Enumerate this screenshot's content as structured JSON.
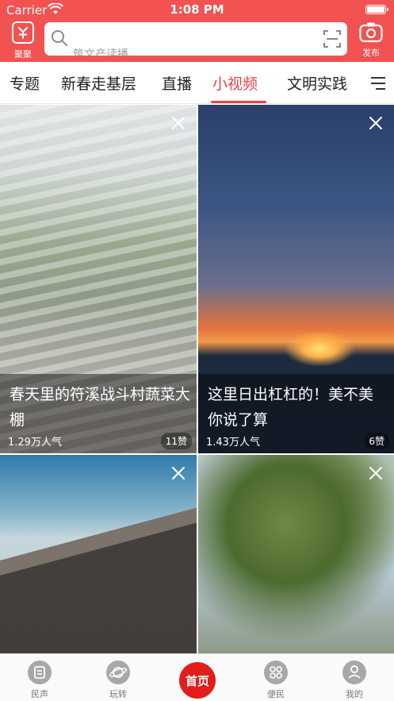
{
  "status_bar": {
    "carrier": "Carrier",
    "time": "1:08 PM"
  },
  "header": {
    "left_button_label": "聚聚",
    "search_placeholder": "筑文产读播",
    "publish_label": "发布"
  },
  "tabs": [
    {
      "label": "专题"
    },
    {
      "label": "新春走基层"
    },
    {
      "label": "直播"
    },
    {
      "label": "小视频",
      "active": true
    },
    {
      "label": "文明实践"
    }
  ],
  "cards": [
    {
      "title": "春天里的符溪战斗村蔬菜大棚",
      "popularity": "1.29万人气",
      "likes": "11赞"
    },
    {
      "title": "这里日出杠杠的！美不美你说了算",
      "popularity": "1.43万人气",
      "likes": "6赞"
    },
    {
      "title": "",
      "popularity": "",
      "likes": ""
    },
    {
      "title": "",
      "popularity": "",
      "likes": ""
    }
  ],
  "bottom_nav": {
    "items": [
      {
        "label": "民声",
        "icon": "people-voice-icon"
      },
      {
        "label": "玩转",
        "icon": "planet-icon"
      },
      {
        "label": "首页",
        "icon": "home-icon"
      },
      {
        "label": "便民",
        "icon": "grid-icon"
      },
      {
        "label": "我的",
        "icon": "profile-icon"
      }
    ]
  },
  "colors": {
    "header_red": "#f25252",
    "accent_red": "#e8424a",
    "home_red": "#e31c1c"
  }
}
